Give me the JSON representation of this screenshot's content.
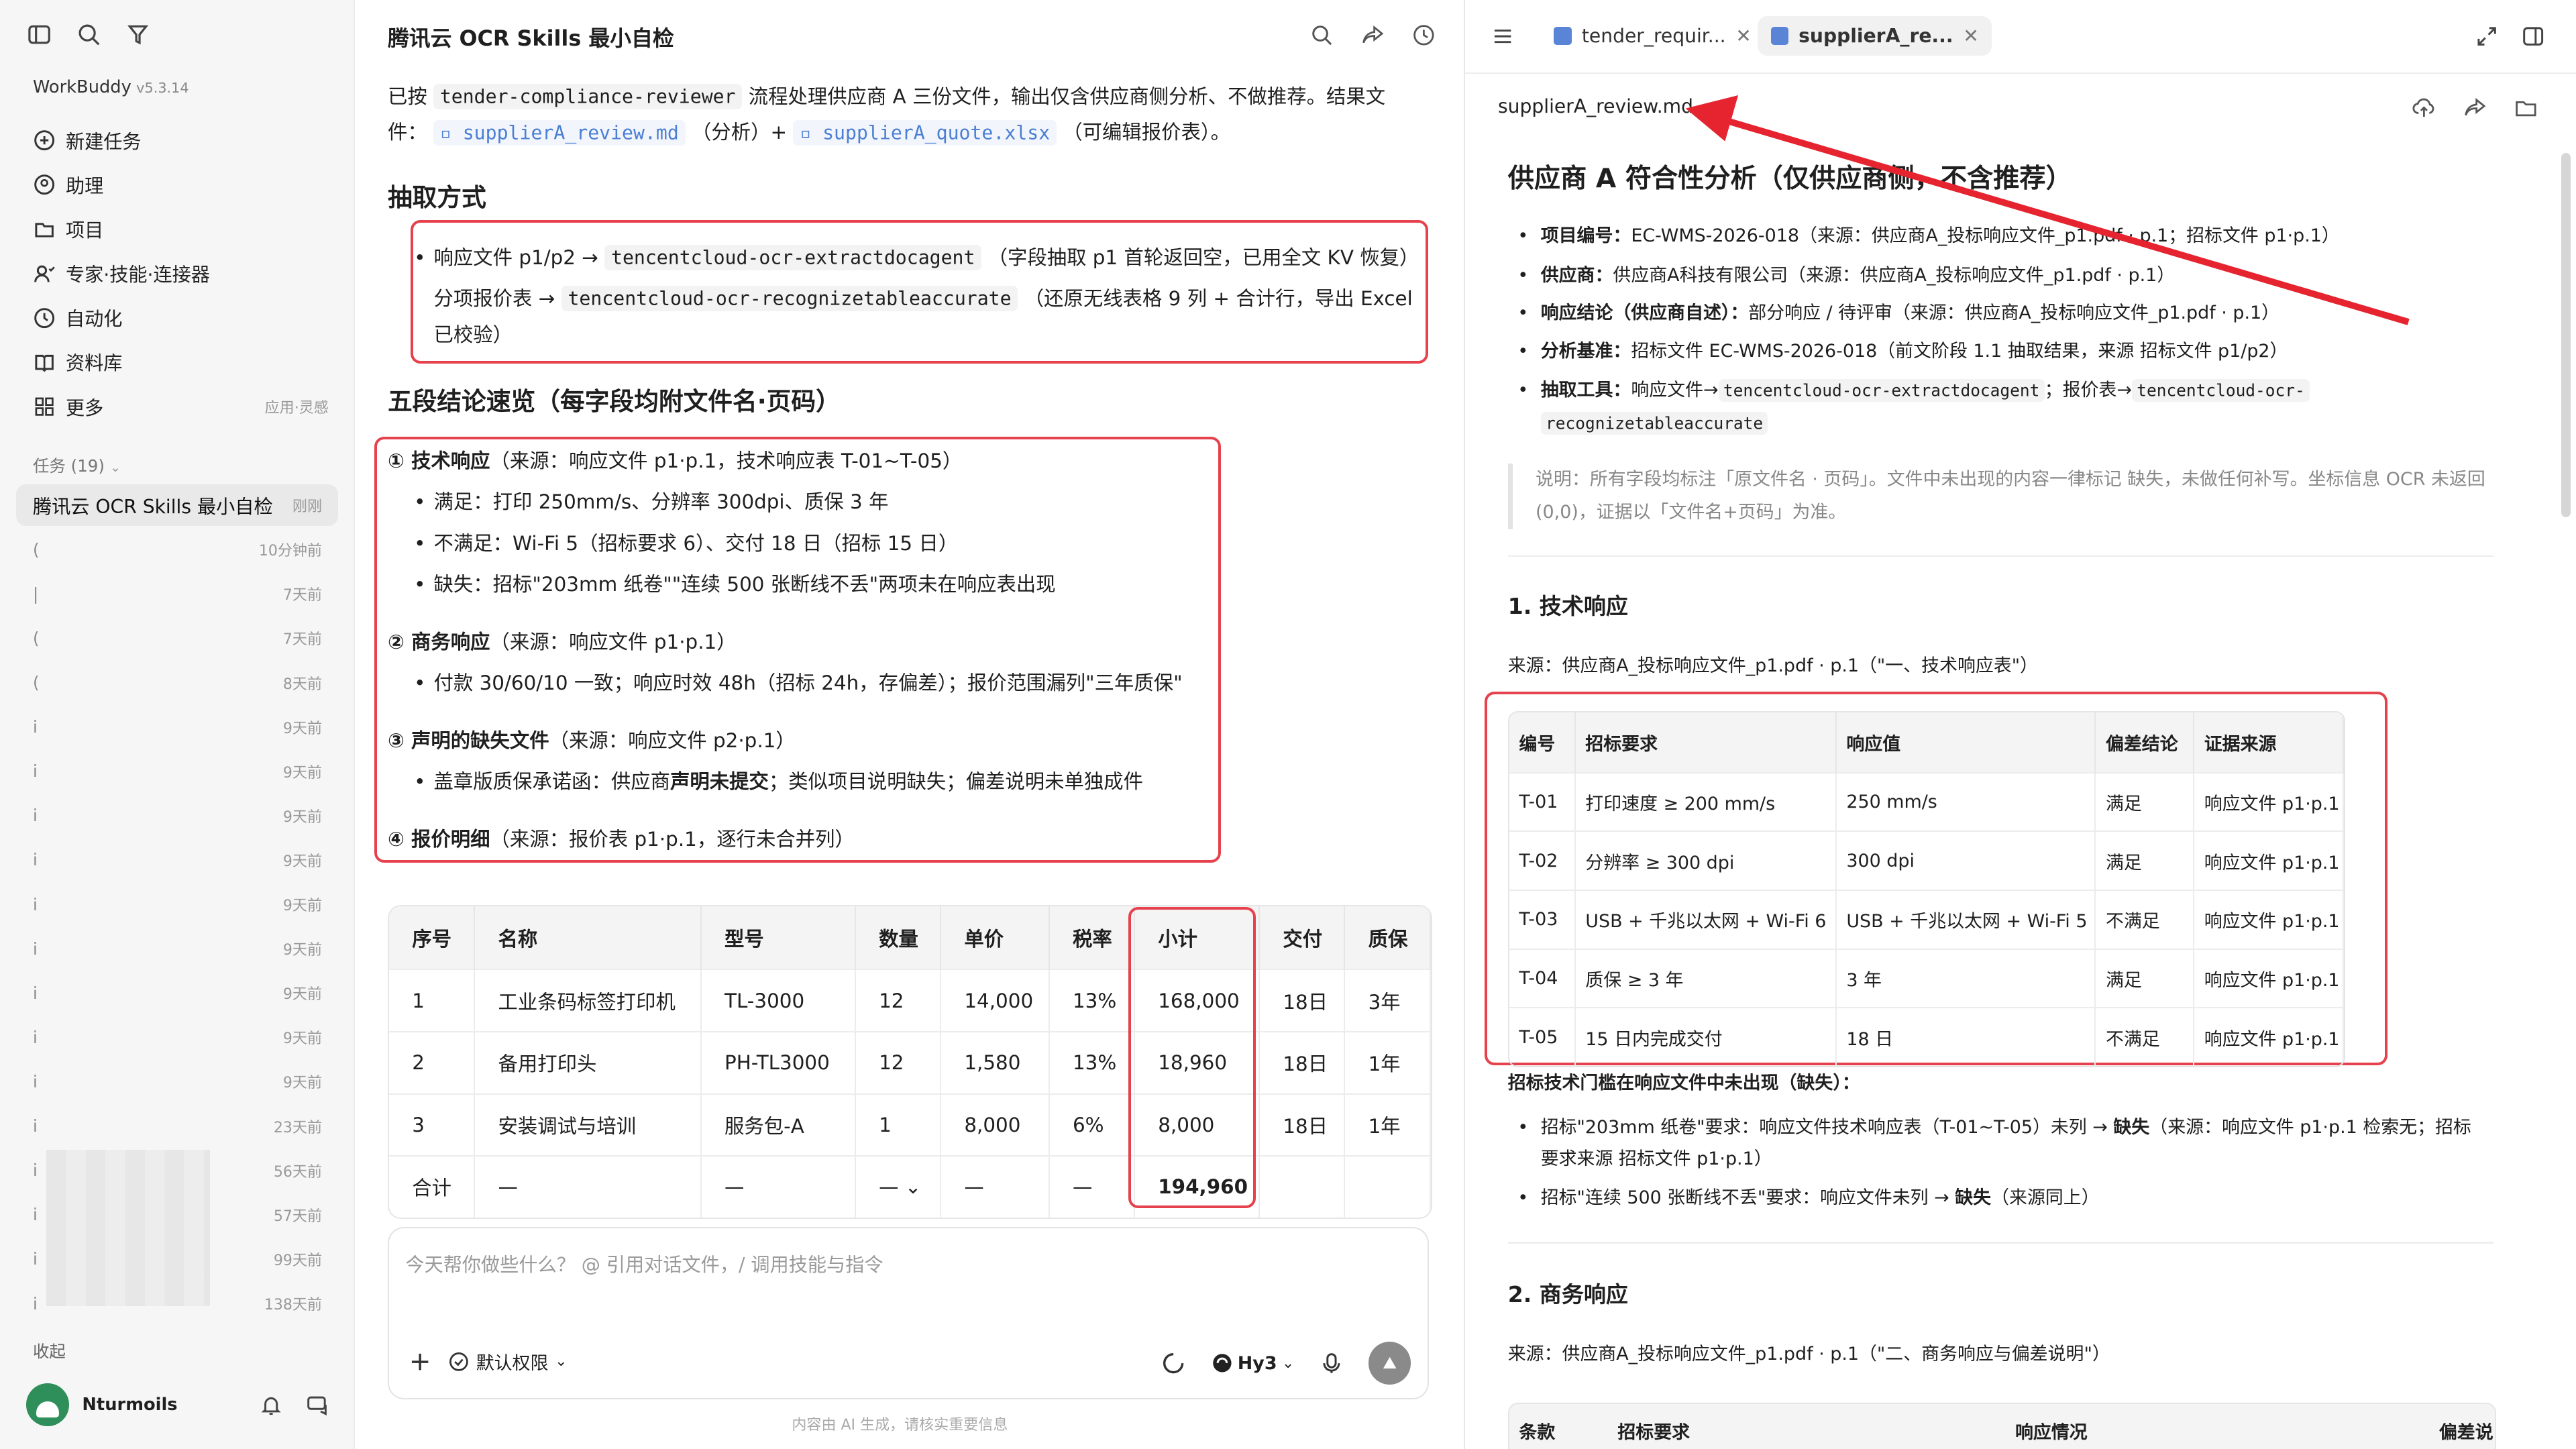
{
  "sidebar": {
    "brand": "WorkBuddy",
    "version": "v5.3.14",
    "nav": [
      {
        "label": "新建任务",
        "icon": "plus-circle-icon"
      },
      {
        "label": "助理",
        "icon": "assistant-icon"
      },
      {
        "label": "项目",
        "icon": "folder-icon"
      },
      {
        "label": "专家·技能·连接器",
        "icon": "expert-icon"
      },
      {
        "label": "自动化",
        "icon": "clock-icon"
      },
      {
        "label": "资料库",
        "icon": "book-icon"
      },
      {
        "label": "更多",
        "icon": "grid-icon",
        "tag": "应用·灵感"
      }
    ],
    "tasks_header": "任务 (19)",
    "active_task": {
      "title": "腾讯云 OCR Skills 最小自检",
      "time": "刚刚"
    },
    "tasks": [
      {
        "mark": "(",
        "time": "10分钟前"
      },
      {
        "mark": "|",
        "time": "7天前"
      },
      {
        "mark": "(",
        "time": "7天前"
      },
      {
        "mark": "(",
        "time": "8天前"
      },
      {
        "mark": "i",
        "time": "9天前"
      },
      {
        "mark": "i",
        "time": "9天前"
      },
      {
        "mark": "i",
        "time": "9天前"
      },
      {
        "mark": "i",
        "time": "9天前"
      },
      {
        "mark": "i",
        "time": "9天前"
      },
      {
        "mark": "i",
        "time": "9天前"
      },
      {
        "mark": "i",
        "time": "9天前"
      },
      {
        "mark": "i",
        "time": "9天前"
      },
      {
        "mark": "i",
        "time": "9天前"
      },
      {
        "mark": "i",
        "time": "23天前"
      },
      {
        "mark": "i",
        "time": "56天前"
      },
      {
        "mark": "i",
        "time": "57天前"
      },
      {
        "mark": "i",
        "time": "99天前"
      },
      {
        "mark": "i",
        "time": "138天前"
      }
    ],
    "collapse": "收起",
    "user": "Nturmoils"
  },
  "center": {
    "title": "腾讯云 OCR Skills 最小自检",
    "intro_1": "已按",
    "intro_code": "tender-compliance-reviewer",
    "intro_2": "流程处理供应商 A 三份文件，输出仅含供应商侧分析、不做推荐。结果文",
    "intro_3": "件：",
    "file1": "supplierA_review.md",
    "intro_4": "（分析）+",
    "file2": "supplierA_quote.xlsx",
    "intro_5": "（可编辑报价表）。",
    "h_extract": "抽取方式",
    "ex1_a": "响应文件 p1/p2 →",
    "ex1_code": "tencentcloud-ocr-extractdocagent",
    "ex1_b": "（字段抽取 p1 首轮返回空，已用全文 KV 恢复）",
    "ex2_a": "分项报价表 →",
    "ex2_code": "tencentcloud-ocr-recognizetableaccurate",
    "ex2_b": "（还原无线表格 9 列 + 合计行，导出 Excel",
    "ex2_c": "已校验）",
    "h_summary": "五段结论速览（每字段均附文件名·页码）",
    "s1_title": "① 技术响应",
    "s1_src": "（来源：响应文件 p1·p.1，技术响应表 T-01~T-05）",
    "s1_b1": "满足：打印 250mm/s、分辨率 300dpi、质保 3 年",
    "s1_b2": "不满足：Wi-Fi 5（招标要求 6）、交付 18 日（招标 15 日）",
    "s1_b3": "缺失：招标\"203mm 纸卷\"\"连续 500 张断线不丢\"两项未在响应表出现",
    "s2_title": "② 商务响应",
    "s2_src": "（来源：响应文件 p1·p.1）",
    "s2_b1": "付款 30/60/10 一致；响应时效 48h（招标 24h，存偏差）；报价范围漏列\"三年质保\"",
    "s3_title": "③ 声明的缺失文件",
    "s3_src": "（来源：响应文件 p2·p.1）",
    "s3_b1_a": "盖章版质保承诺函：供应商",
    "s3_b1_bold": "声明未提交",
    "s3_b1_b": "；类似项目说明缺失；偏差说明未单独成件",
    "s4_title": "④ 报价明细",
    "s4_src": "（来源：报价表 p1·p.1，逐行未合并列）",
    "quote_headers": [
      "序号",
      "名称",
      "型号",
      "数量",
      "单价",
      "税率",
      "小计",
      "交付",
      "质保"
    ],
    "quote_rows": [
      [
        "1",
        "工业条码标签打印机",
        "TL-3000",
        "12",
        "14,000",
        "13%",
        "168,000",
        "18日",
        "3年"
      ],
      [
        "2",
        "备用打印头",
        "PH-TL3000",
        "12",
        "1,580",
        "13%",
        "18,960",
        "18日",
        "1年"
      ],
      [
        "3",
        "安装调试与培训",
        "服务包-A",
        "1",
        "8,000",
        "6%",
        "8,000",
        "18日",
        "1年"
      ],
      [
        "合计",
        "—",
        "—",
        "—",
        "—",
        "—",
        "194,960",
        "",
        ""
      ]
    ],
    "composer_placeholder": "今天帮你做些什么？ @ 引用对话文件，/ 调用技能与指令",
    "permission": "默认权限",
    "model": "Hy3",
    "disclaimer": "内容由 AI 生成，请核实重要信息"
  },
  "right": {
    "tab1": "tender_requir...",
    "tab2": "supplierA_re...",
    "filename": "supplierA_review.md",
    "h1": "供应商 A 符合性分析（仅供应商侧，不含推荐）",
    "m1_k": "项目编号：",
    "m1_v": "EC-WMS-2026-018（来源：供应商A_投标响应文件_p1.pdf · p.1；招标文件 p1·p.1）",
    "m2_k": "供应商：",
    "m2_v": "供应商A科技有限公司（来源：供应商A_投标响应文件_p1.pdf · p.1）",
    "m3_k": "响应结论（供应商自述）：",
    "m3_v": "部分响应 / 待评审（来源：供应商A_投标响应文件_p1.pdf · p.1）",
    "m4_k": "分析基准：",
    "m4_v": "招标文件 EC-WMS-2026-018（前文阶段 1.1 抽取结果，来源 招标文件 p1/p2）",
    "m5_k": "抽取工具：",
    "m5_a": "响应文件→",
    "m5_c1": "tencentcloud-ocr-extractdocagent",
    "m5_b": "；报价表→",
    "m5_c2": "tencentcloud-ocr-",
    "m5_c3": "recognizetableaccurate",
    "note": "说明：所有字段均标注「原文件名 · 页码」。文件中未出现的内容一律标记 缺失，未做任何补写。坐标信息 OCR 未返回 (0,0)，证据以「文件名+页码」为准。",
    "h3_tech": "1. 技术响应",
    "src_tech": "来源：供应商A_投标响应文件_p1.pdf · p.1（\"一、技术响应表\"）",
    "tech_headers": [
      "编号",
      "招标要求",
      "响应值",
      "偏差结论",
      "证据来源"
    ],
    "tech_rows": [
      [
        "T-01",
        "打印速度 ≥ 200 mm/s",
        "250 mm/s",
        "满足",
        "响应文件 p1·p.1"
      ],
      [
        "T-02",
        "分辨率 ≥ 300 dpi",
        "300 dpi",
        "满足",
        "响应文件 p1·p.1"
      ],
      [
        "T-03",
        "USB + 千兆以太网 + Wi-Fi 6",
        "USB + 千兆以太网 + Wi-Fi 5",
        "不满足",
        "响应文件 p1·p.1"
      ],
      [
        "T-04",
        "质保 ≥ 3 年",
        "3 年",
        "满足",
        "响应文件 p1·p.1"
      ],
      [
        "T-05",
        "15 日内完成交付",
        "18 日",
        "不满足",
        "响应文件 p1·p.1"
      ]
    ],
    "missing_h": "招标技术门槛在响应文件中未出现（缺失）：",
    "miss1_a": "招标\"203mm 纸卷\"要求：响应文件技术响应表（T-01~T-05）未列 →",
    "miss1_bold": "缺失",
    "miss1_b": "（来源：响应文件 p1·p.1 检索无；招标",
    "miss1_c": "要求来源 招标文件 p1·p.1）",
    "miss2_a": "招标\"连续 500 张断线不丢\"要求：响应文件未列 →",
    "miss2_bold": "缺失",
    "miss2_b": "（来源同上）",
    "h3_biz": "2. 商务响应",
    "src_biz": "来源：供应商A_投标响应文件_p1.pdf · p.1（\"二、商务响应与偏差说明\"）",
    "biz_headers": [
      "条款",
      "招标要求",
      "响应情况",
      "偏差说"
    ]
  }
}
